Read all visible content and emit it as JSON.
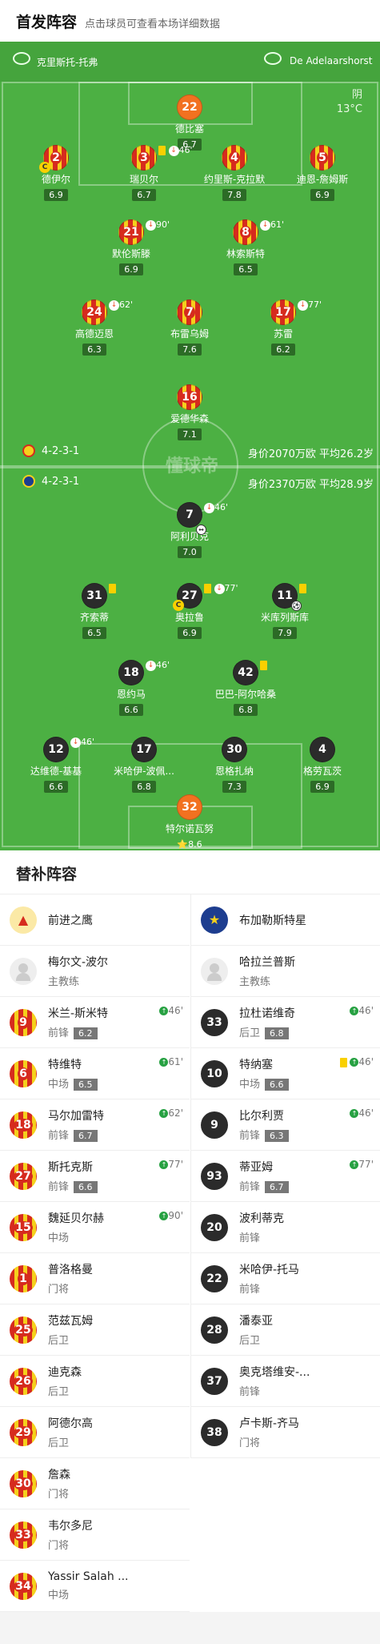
{
  "header": {
    "title": "首发阵容",
    "subtitle": "点击球员可查看本场详细数据"
  },
  "teams": {
    "home": "克里斯托-托弗",
    "away": "De Adelaarshorst"
  },
  "weather": {
    "condition": "阴",
    "temp": "13°C"
  },
  "home_formation": {
    "shape": "4-2-3-1",
    "value": "身价2070万欧 平均26.2岁"
  },
  "away_formation": {
    "shape": "4-2-3-1",
    "value": "身价2370万欧 平均28.9岁"
  },
  "watermark": "懂球帝",
  "home_players": [
    {
      "num": "22",
      "name": "德比塞",
      "rating": "6.7",
      "mark": ""
    },
    {
      "num": "2",
      "name": "德伊尔",
      "rating": "6.9",
      "mark": ""
    },
    {
      "num": "3",
      "name": "瑞贝尔",
      "rating": "6.7",
      "mark": "46'"
    },
    {
      "num": "4",
      "name": "约里斯-克拉默",
      "rating": "7.8",
      "mark": ""
    },
    {
      "num": "5",
      "name": "迪恩-詹姆斯",
      "rating": "6.9",
      "mark": ""
    },
    {
      "num": "21",
      "name": "默伦斯滕",
      "rating": "6.9",
      "mark": "90'"
    },
    {
      "num": "8",
      "name": "林索斯特",
      "rating": "6.5",
      "mark": "61'"
    },
    {
      "num": "24",
      "name": "高德迈恩",
      "rating": "6.3",
      "mark": "62'"
    },
    {
      "num": "7",
      "name": "布雷乌姆",
      "rating": "7.6",
      "mark": ""
    },
    {
      "num": "17",
      "name": "苏雷",
      "rating": "6.2",
      "mark": "77'"
    },
    {
      "num": "16",
      "name": "爱德华森",
      "rating": "7.1",
      "mark": ""
    }
  ],
  "away_players": [
    {
      "num": "7",
      "name": "阿利贝克",
      "rating": "7.0",
      "mark": "46'"
    },
    {
      "num": "31",
      "name": "齐索蒂",
      "rating": "6.5",
      "mark": ""
    },
    {
      "num": "27",
      "name": "奥拉鲁",
      "rating": "6.9",
      "mark": "77'"
    },
    {
      "num": "11",
      "name": "米库列斯库",
      "rating": "7.9",
      "mark": ""
    },
    {
      "num": "18",
      "name": "恩约马",
      "rating": "6.6",
      "mark": "46'"
    },
    {
      "num": "42",
      "name": "巴巴-阿尔哈桑",
      "rating": "6.8",
      "mark": ""
    },
    {
      "num": "12",
      "name": "达维德-基基",
      "rating": "6.6",
      "mark": "46'"
    },
    {
      "num": "17",
      "name": "米哈伊-波佩...",
      "rating": "6.8",
      "mark": ""
    },
    {
      "num": "30",
      "name": "恩格扎纳",
      "rating": "7.3",
      "mark": ""
    },
    {
      "num": "4",
      "name": "格劳瓦茨",
      "rating": "6.9",
      "mark": ""
    },
    {
      "num": "32",
      "name": "特尔诺瓦努",
      "rating": "8.6",
      "mark": ""
    }
  ],
  "subs": {
    "title": "替补阵容",
    "home": {
      "team": "前进之鹰",
      "coach": "梅尔文-波尔",
      "coach_role": "主教练",
      "rows": [
        {
          "num": "9",
          "name": "米兰-斯米特",
          "pos": "前锋",
          "rating": "6.2",
          "min": "46'"
        },
        {
          "num": "6",
          "name": "特维特",
          "pos": "中场",
          "rating": "6.5",
          "min": "61'"
        },
        {
          "num": "18",
          "name": "马尔加雷特",
          "pos": "前锋",
          "rating": "6.7",
          "min": "62'"
        },
        {
          "num": "27",
          "name": "斯托克斯",
          "pos": "前锋",
          "rating": "6.6",
          "min": "77'"
        },
        {
          "num": "15",
          "name": "魏延贝尔赫",
          "pos": "中场",
          "rating": "",
          "min": "90'"
        },
        {
          "num": "1",
          "name": "普洛格曼",
          "pos": "门将",
          "rating": "",
          "min": ""
        },
        {
          "num": "25",
          "name": "范兹瓦姆",
          "pos": "后卫",
          "rating": "",
          "min": ""
        },
        {
          "num": "26",
          "name": "迪克森",
          "pos": "后卫",
          "rating": "",
          "min": ""
        },
        {
          "num": "29",
          "name": "阿德尔高",
          "pos": "后卫",
          "rating": "",
          "min": ""
        },
        {
          "num": "30",
          "name": "詹森",
          "pos": "门将",
          "rating": "",
          "min": ""
        },
        {
          "num": "33",
          "name": "韦尔多尼",
          "pos": "门将",
          "rating": "",
          "min": ""
        },
        {
          "num": "34",
          "name": "Yassir Salah ...",
          "pos": "中场",
          "rating": "",
          "min": ""
        }
      ]
    },
    "away": {
      "team": "布加勒斯特星",
      "coach": "哈拉兰普斯",
      "coach_role": "主教练",
      "rows": [
        {
          "num": "33",
          "name": "拉杜诺维奇",
          "pos": "后卫",
          "rating": "6.8",
          "min": "46'"
        },
        {
          "num": "10",
          "name": "特纳塞",
          "pos": "中场",
          "rating": "6.6",
          "min": "46'"
        },
        {
          "num": "9",
          "name": "比尔利贾",
          "pos": "前锋",
          "rating": "6.3",
          "min": "46'"
        },
        {
          "num": "93",
          "name": "蒂亚姆",
          "pos": "前锋",
          "rating": "6.7",
          "min": "77'"
        },
        {
          "num": "20",
          "name": "波利蒂克",
          "pos": "前锋",
          "rating": "",
          "min": ""
        },
        {
          "num": "22",
          "name": "米哈伊-托马",
          "pos": "前锋",
          "rating": "",
          "min": ""
        },
        {
          "num": "28",
          "name": "潘泰亚",
          "pos": "后卫",
          "rating": "",
          "min": ""
        },
        {
          "num": "37",
          "name": "奥克塔维安-...",
          "pos": "前锋",
          "rating": "",
          "min": ""
        },
        {
          "num": "38",
          "name": "卢卡斯-齐马",
          "pos": "门将",
          "rating": "",
          "min": ""
        }
      ]
    }
  }
}
